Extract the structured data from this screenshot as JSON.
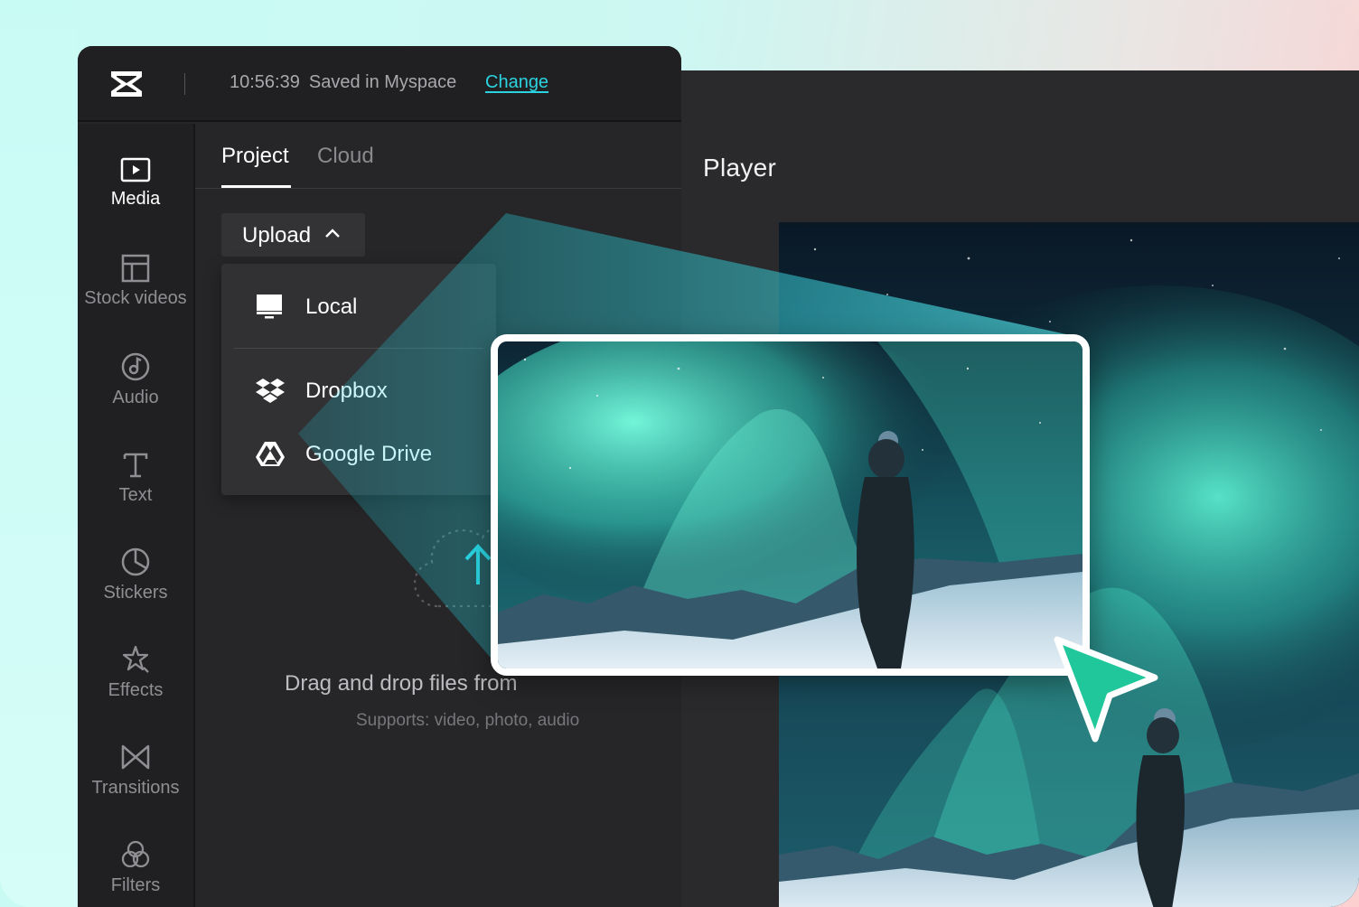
{
  "header": {
    "time": "10:56:39",
    "save_status": "Saved in Myspace",
    "change_label": "Change"
  },
  "sidebar": {
    "items": [
      {
        "label": "Media",
        "icon": "media-icon",
        "active": true
      },
      {
        "label": "Stock videos",
        "icon": "stock-videos-icon"
      },
      {
        "label": "Audio",
        "icon": "audio-icon"
      },
      {
        "label": "Text",
        "icon": "text-icon"
      },
      {
        "label": "Stickers",
        "icon": "stickers-icon"
      },
      {
        "label": "Effects",
        "icon": "effects-icon"
      },
      {
        "label": "Transitions",
        "icon": "transitions-icon"
      },
      {
        "label": "Filters",
        "icon": "filters-icon"
      }
    ]
  },
  "tabs": [
    {
      "label": "Project",
      "active": true
    },
    {
      "label": "Cloud"
    }
  ],
  "upload": {
    "label": "Upload",
    "menu": [
      {
        "label": "Local",
        "icon": "monitor-icon"
      },
      {
        "label": "Dropbox",
        "icon": "dropbox-icon"
      },
      {
        "label": "Google Drive",
        "icon": "google-drive-icon"
      }
    ]
  },
  "drop_area": {
    "title": "Drag and drop files from",
    "subtitle": "Supports: video, photo, audio"
  },
  "player": {
    "title": "Player"
  },
  "colors": {
    "accent": "#2bd3e0",
    "cursor": "#1fc79a",
    "panel": "#262628"
  }
}
